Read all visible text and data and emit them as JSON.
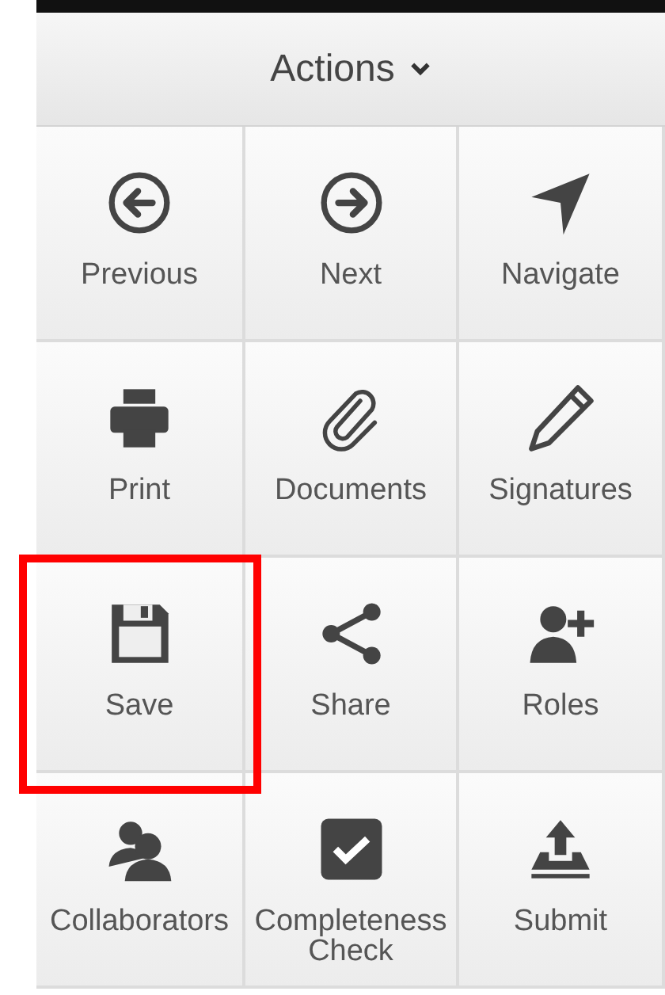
{
  "header": {
    "title": "Actions"
  },
  "actions": [
    {
      "label": "Previous",
      "highlighted": false
    },
    {
      "label": "Next",
      "highlighted": false
    },
    {
      "label": "Navigate",
      "highlighted": false
    },
    {
      "label": "Print",
      "highlighted": false
    },
    {
      "label": "Documents",
      "highlighted": false
    },
    {
      "label": "Signatures",
      "highlighted": false
    },
    {
      "label": "Save",
      "highlighted": true
    },
    {
      "label": "Share",
      "highlighted": false
    },
    {
      "label": "Roles",
      "highlighted": false
    },
    {
      "label": "Collaborators",
      "highlighted": false
    },
    {
      "label": "Completeness Check",
      "highlighted": false
    },
    {
      "label": "Submit",
      "highlighted": false
    }
  ]
}
